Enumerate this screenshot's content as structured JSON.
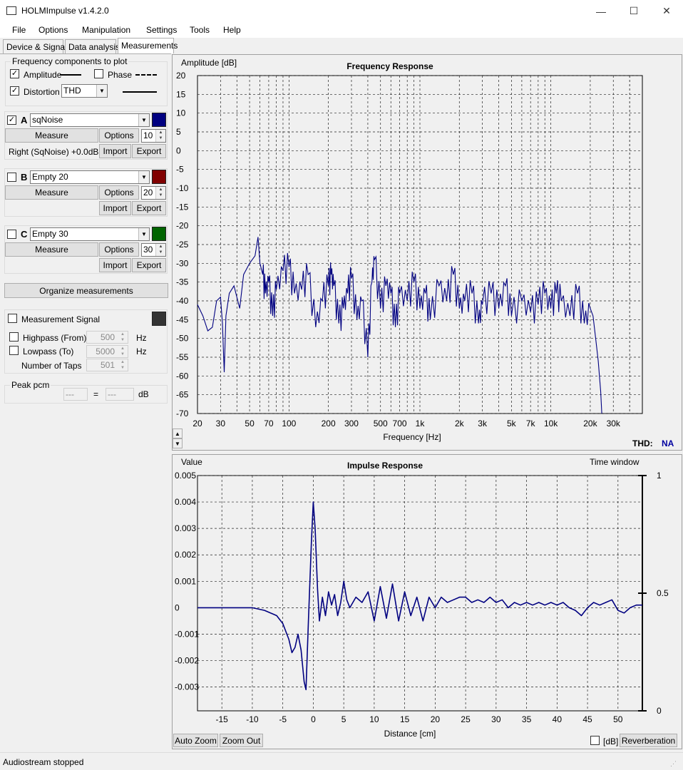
{
  "window": {
    "title": "HOLMImpulse  v1.4.2.0",
    "minimize": "—",
    "maximize": "☐",
    "close": "✕"
  },
  "menu": [
    "File",
    "Options",
    "Manipulation",
    "Settings",
    "Tools",
    "Help"
  ],
  "tabs": [
    "Device & Signal",
    "Data analysis",
    "Measurements"
  ],
  "freq_components": {
    "title": "Frequency components to plot",
    "amplitude": {
      "label": "Amplitude",
      "checked": true
    },
    "phase": {
      "label": "Phase",
      "checked": false
    },
    "distortion": {
      "label": "Distortion",
      "checked": true,
      "value": "THD"
    }
  },
  "measurements": [
    {
      "letter": "A",
      "checked": true,
      "name": "sqNoise",
      "color": "#000080",
      "measure": "Measure",
      "options": "Options",
      "count": "10",
      "info": "Right (SqNoise) +0.0dB",
      "import": "Import",
      "export": "Export"
    },
    {
      "letter": "B",
      "checked": false,
      "name": "Empty 20",
      "color": "#800000",
      "measure": "Measure",
      "options": "Options",
      "count": "20",
      "info": "",
      "import": "Import",
      "export": "Export"
    },
    {
      "letter": "C",
      "checked": false,
      "name": "Empty 30",
      "color": "#006400",
      "measure": "Measure",
      "options": "Options",
      "count": "30",
      "info": "",
      "import": "Import",
      "export": "Export"
    }
  ],
  "organize": "Organize measurements",
  "signal": {
    "label": "Measurement Signal",
    "color": "#333333",
    "highpass": {
      "label": "Highpass (From)",
      "value": "500",
      "unit": "Hz"
    },
    "lowpass": {
      "label": "Lowpass (To)",
      "value": "5000",
      "unit": "Hz"
    },
    "taps": {
      "label": "Number of Taps",
      "value": "501"
    }
  },
  "peak": {
    "title": "Peak pcm",
    "left": "---",
    "eq": "=",
    "right": "---",
    "unit": "dB"
  },
  "thd": {
    "label": "THD:",
    "value": "NA"
  },
  "impulse_controls": {
    "time_window": "Time window",
    "db": "[dB]",
    "reverberation": "Reverberation",
    "auto_zoom": "Auto Zoom",
    "zoom_out": "Zoom Out"
  },
  "status": "Audiostream stopped",
  "chart_data": [
    {
      "type": "line",
      "title": "Frequency Response",
      "ylabel": "Amplitude [dB]",
      "xlabel": "Frequency [Hz]",
      "xscale": "log",
      "xlim": [
        20,
        50000
      ],
      "ylim": [
        -70,
        20
      ],
      "xticks": [
        {
          "v": 20,
          "l": "20"
        },
        {
          "v": 30,
          "l": "30"
        },
        {
          "v": 50,
          "l": "50"
        },
        {
          "v": 70,
          "l": "70"
        },
        {
          "v": 100,
          "l": "100"
        },
        {
          "v": 200,
          "l": "200"
        },
        {
          "v": 300,
          "l": "300"
        },
        {
          "v": 500,
          "l": "500"
        },
        {
          "v": 700,
          "l": "700"
        },
        {
          "v": 1000,
          "l": "1k"
        },
        {
          "v": 2000,
          "l": "2k"
        },
        {
          "v": 3000,
          "l": "3k"
        },
        {
          "v": 5000,
          "l": "5k"
        },
        {
          "v": 7000,
          "l": "7k"
        },
        {
          "v": 10000,
          "l": "10k"
        },
        {
          "v": 20000,
          "l": "20k"
        },
        {
          "v": 30000,
          "l": "30k"
        }
      ],
      "yticks": [
        20,
        15,
        10,
        5,
        0,
        -5,
        -10,
        -15,
        -20,
        -25,
        -30,
        -35,
        -40,
        -45,
        -50,
        -55,
        -60,
        -65,
        -70
      ],
      "series": [
        {
          "color": "#000080",
          "x": [
            20,
            22,
            24,
            26,
            28,
            30,
            31,
            32,
            33,
            35,
            38,
            42,
            45,
            50,
            55,
            58,
            60,
            63,
            66,
            70,
            75,
            80,
            90,
            100,
            110,
            125,
            140,
            160,
            180,
            200,
            210,
            220,
            240,
            260,
            280,
            300,
            330,
            360,
            400,
            430,
            450,
            500,
            550,
            600,
            650,
            700,
            800,
            900,
            1000,
            1100,
            1200,
            1400,
            1600,
            1800,
            2000,
            2200,
            2500,
            2800,
            3000,
            3500,
            4000,
            4500,
            5000,
            6000,
            7000,
            8000,
            9000,
            10000,
            11000,
            12000,
            14000,
            16000,
            18000,
            20000,
            21000,
            22000,
            23000,
            24000,
            24500
          ],
          "y": [
            -41,
            -44,
            -48,
            -47,
            -40,
            -39,
            -46,
            -59,
            -44,
            -38,
            -36,
            -42,
            -33,
            -30,
            -28,
            -23,
            -30,
            -33,
            -38,
            -35,
            -44,
            -37,
            -32,
            -31,
            -38,
            -37,
            -33,
            -47,
            -40,
            -36,
            -33,
            -36,
            -46,
            -42,
            -38,
            -34,
            -45,
            -40,
            -55,
            -35,
            -29,
            -42,
            -36,
            -38,
            -47,
            -38,
            -40,
            -35,
            -42,
            -38,
            -45,
            -36,
            -40,
            -33,
            -42,
            -40,
            -38,
            -46,
            -41,
            -38,
            -42,
            -36,
            -44,
            -40,
            -43,
            -41,
            -38,
            -42,
            -38,
            -40,
            -44,
            -38,
            -46,
            -42,
            -44,
            -50,
            -56,
            -64,
            -70
          ]
        }
      ]
    },
    {
      "type": "line",
      "title": "Impulse Response",
      "ylabel": "Value",
      "xlabel": "Distance [cm]",
      "xlim": [
        -19,
        54
      ],
      "ylim": [
        -0.0039,
        0.005
      ],
      "xticks": [
        -15,
        -10,
        -5,
        0,
        5,
        10,
        15,
        20,
        25,
        30,
        35,
        40,
        45,
        50
      ],
      "yticks": [
        {
          "v": 0.005,
          "l": "0.005"
        },
        {
          "v": 0.004,
          "l": "0.004"
        },
        {
          "v": 0.003,
          "l": "0.003"
        },
        {
          "v": 0.002,
          "l": "0.002"
        },
        {
          "v": 0.001,
          "l": "0.001"
        },
        {
          "v": 0,
          "l": "0"
        },
        {
          "v": -0.001,
          "l": "-0.001"
        },
        {
          "v": -0.002,
          "l": "-0.002"
        },
        {
          "v": -0.003,
          "l": "-0.003"
        }
      ],
      "y2": {
        "label": "Time window",
        "ticks": [
          {
            "v": 1,
            "l": "1"
          },
          {
            "v": 0.5,
            "l": "0.5"
          },
          {
            "v": 0,
            "l": "0"
          }
        ]
      },
      "series": [
        {
          "color": "#000080",
          "x": [
            -19,
            -15,
            -12,
            -10,
            -8,
            -6,
            -5,
            -4,
            -3.5,
            -3,
            -2.5,
            -2,
            -1.5,
            -1.2,
            -0.8,
            -0.3,
            0,
            0.3,
            0.7,
            1,
            1.5,
            2,
            2.5,
            3,
            3.5,
            4,
            4.5,
            5,
            5.5,
            6,
            7,
            8,
            9,
            10,
            11,
            12,
            13,
            14,
            15,
            16,
            17,
            18,
            19,
            20,
            21,
            22,
            23,
            24,
            25,
            26,
            27,
            28,
            29,
            30,
            31,
            32,
            33,
            34,
            35,
            36,
            37,
            38,
            39,
            40,
            41,
            42,
            43,
            44,
            45,
            46,
            47,
            48,
            49,
            50,
            51,
            52,
            53,
            54
          ],
          "y": [
            0,
            0,
            0,
            0,
            -0.0001,
            -0.0003,
            -0.0006,
            -0.0012,
            -0.0017,
            -0.0015,
            -0.001,
            -0.0016,
            -0.0028,
            -0.0031,
            -0.0005,
            0.0025,
            0.004,
            0.003,
            0.0007,
            -0.0005,
            0.0004,
            -0.0003,
            0.0006,
            0.0001,
            0.0005,
            -0.0003,
            0.0002,
            0.001,
            0.0003,
            0,
            0.0004,
            0.0002,
            0.0006,
            -0.0005,
            0.0008,
            -0.0004,
            0.0009,
            -0.0005,
            0.0006,
            -0.0003,
            0.0004,
            -0.0005,
            0.0004,
            0,
            0.0004,
            0.0002,
            0.0003,
            0.0004,
            0.0004,
            0.0002,
            0.0003,
            0.0002,
            0.0004,
            0.0002,
            0.0003,
            0,
            0.0002,
            0.0001,
            0.0002,
            0.0001,
            0.0002,
            0.0001,
            0.0002,
            0.0001,
            0.0002,
            0,
            -0.0001,
            -0.0003,
            0,
            0.0002,
            0.0001,
            0.0002,
            0.0003,
            -0.0001,
            -0.0002,
            0,
            0.0001,
            0.0001
          ]
        }
      ]
    }
  ]
}
